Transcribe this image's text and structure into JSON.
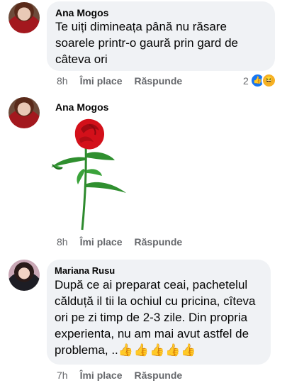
{
  "comments": [
    {
      "author": "Ana Mogos",
      "lines": [
        "Te uiți dimineața până nu răsare",
        "soarele printr-o gaură prin gard de",
        "câteva ori"
      ],
      "time": "8h",
      "like_label": "Îmi place",
      "reply_label": "Răspunde",
      "reaction_count": "2",
      "reaction_icons": [
        "like-icon",
        "haha-icon"
      ]
    },
    {
      "author": "Ana Mogos",
      "image": "red-rose-image",
      "time": "8h",
      "like_label": "Îmi place",
      "reply_label": "Răspunde"
    },
    {
      "author": "Mariana Rusu",
      "lines": [
        "După ce ai preparat ceai, pachetelul",
        "călduță il tii la ochiul cu pricina, cîteva",
        "ori pe zi timp de 2-3 zile. Din propria",
        "experienta,  nu am mai avut astfel de",
        "problema, .."
      ],
      "emoji": "👍👍👍👍👍",
      "time": "7h",
      "like_label": "Îmi place",
      "reply_label": "Răspunde"
    }
  ],
  "colors": {
    "bubble": "#f0f2f5",
    "meta": "#65676b",
    "like_blue": "#1877f2",
    "rose_red": "#d3101a",
    "stem_green": "#2d8a2d"
  }
}
